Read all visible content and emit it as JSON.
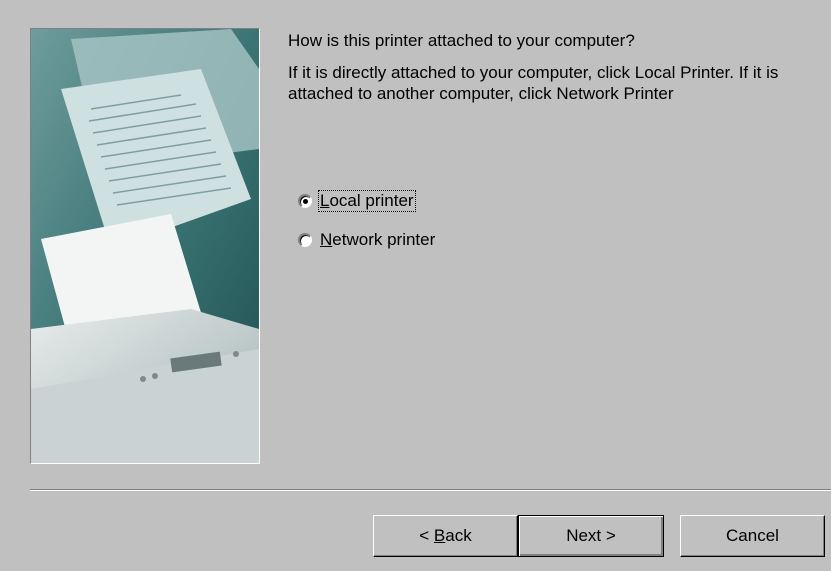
{
  "wizard": {
    "question": "How is this printer attached to your computer?",
    "instruction": "If it is directly attached to your computer, click Local Printer. If it is attached to another computer, click Network Printer",
    "image_icon": "printer-illustration",
    "options": [
      {
        "label_mnemonic": "L",
        "label_rest": "ocal printer",
        "selected": true
      },
      {
        "label_mnemonic": "N",
        "label_rest": "etwork printer",
        "selected": false
      }
    ]
  },
  "buttons": {
    "back_prefix": "< ",
    "back_mnemonic": "B",
    "back_rest": "ack",
    "next": "Next >",
    "cancel": "Cancel"
  },
  "colors": {
    "face": "#c0c0c0",
    "shadow": "#808080",
    "highlight": "#ffffff"
  }
}
